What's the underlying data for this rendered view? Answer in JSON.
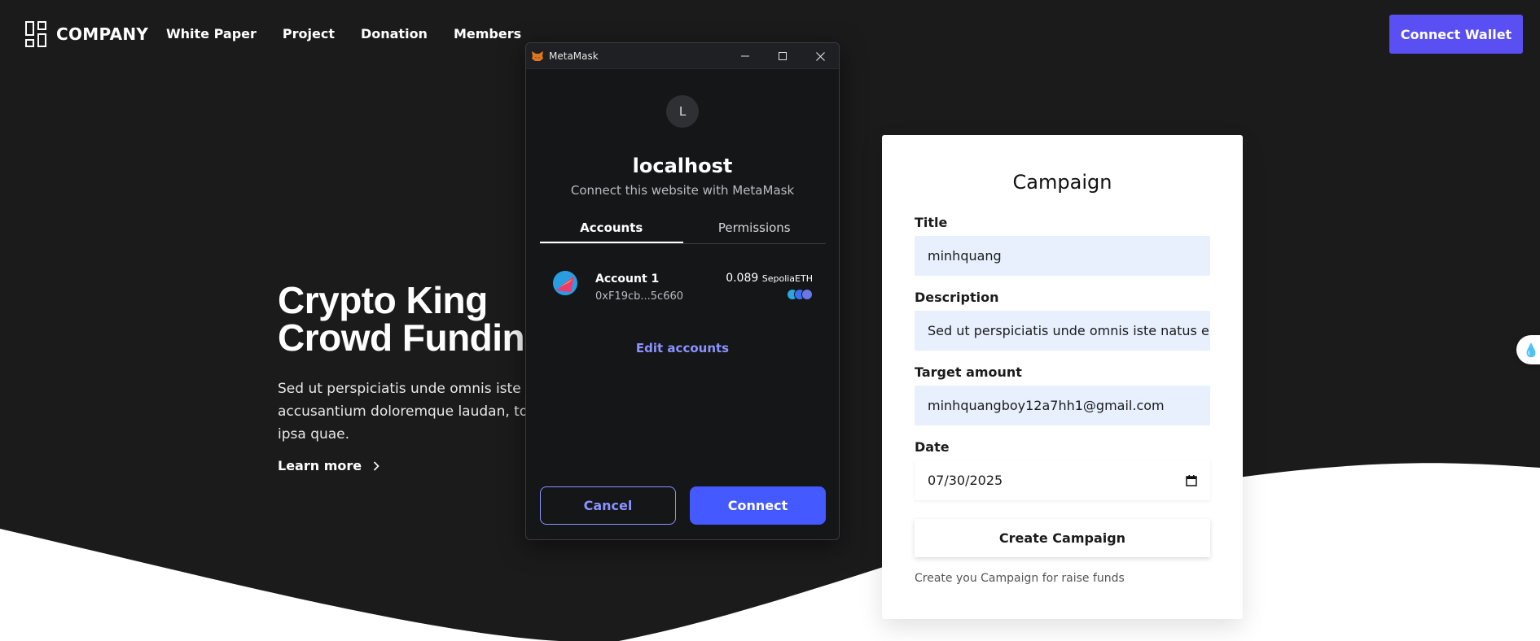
{
  "header": {
    "logo_text": "COMPANY",
    "nav": [
      "White Paper",
      "Project",
      "Donation",
      "Members"
    ],
    "connect_wallet": "Connect Wallet"
  },
  "hero": {
    "title_line1": "Crypto King",
    "title_line2": "Crowd Fundin",
    "desc_line1": "Sed ut perspiciatis unde omnis iste nat",
    "desc_line2": "accusantium doloremque laudan, totar",
    "desc_line3": "ipsa quae.",
    "learn_more": "Learn more"
  },
  "campaign": {
    "title": "Campaign",
    "title_label": "Title",
    "title_value": "minhquang",
    "description_label": "Description",
    "description_value": "Sed ut perspiciatis unde omnis iste natus error",
    "target_label": "Target amount",
    "target_value": "minhquangboy12a7hh1@gmail.com",
    "date_label": "Date",
    "date_value": "07/30/2025",
    "create_button": "Create Campaign",
    "note": "Create you Campaign for raise funds"
  },
  "metamask": {
    "window_title": "MetaMask",
    "avatar_letter": "L",
    "host": "localhost",
    "subtitle": "Connect this website with MetaMask",
    "tabs": [
      "Accounts",
      "Permissions"
    ],
    "account": {
      "name": "Account 1",
      "address": "0xF19cb...5c660",
      "balance": "0.089",
      "unit": "SepoliaETH"
    },
    "edit_accounts": "Edit accounts",
    "cancel": "Cancel",
    "connect": "Connect"
  },
  "colors": {
    "background": "#1b1b1c",
    "accent": "#5a4ff3",
    "mm_primary": "#4459ff",
    "mm_link": "#8b93ff"
  }
}
